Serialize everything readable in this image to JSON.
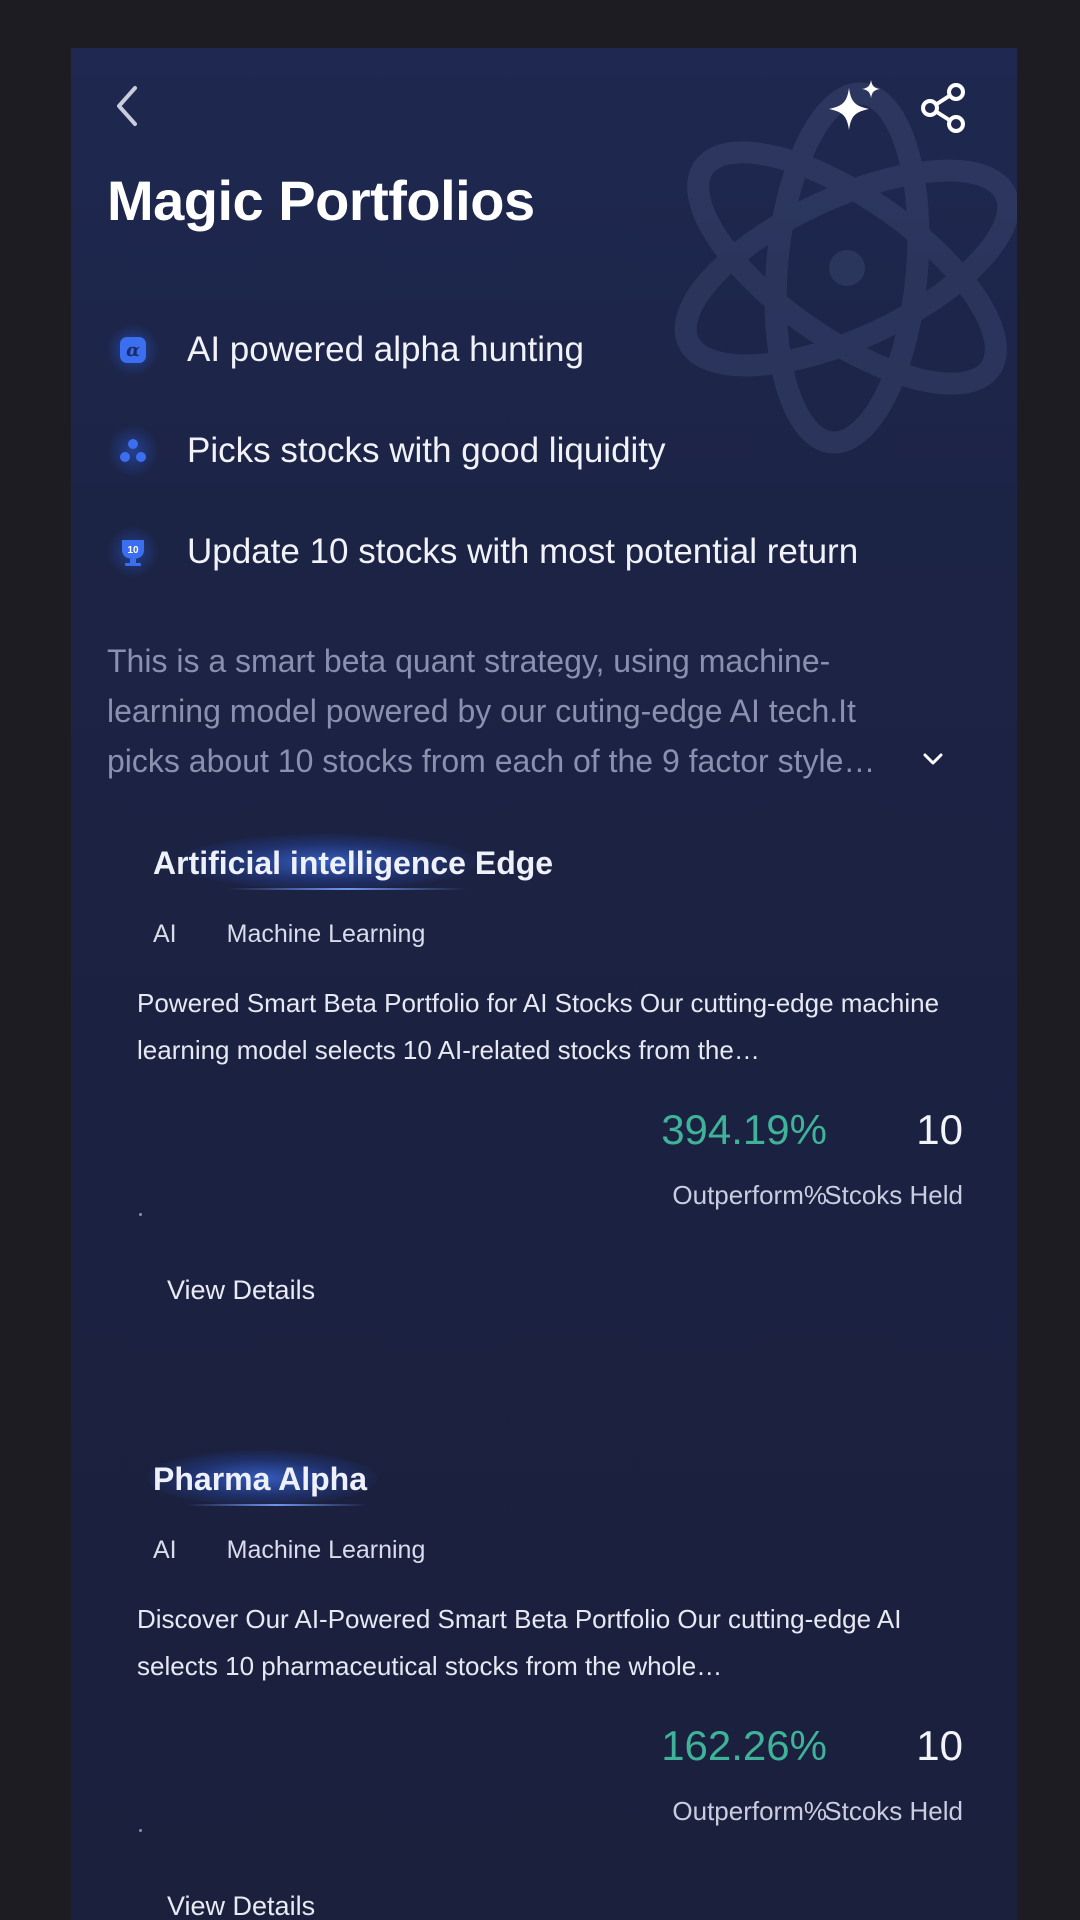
{
  "header": {
    "title": "Magic Portfolios",
    "back_icon": "chevron-left-icon",
    "sparkle_icon": "sparkle-icon",
    "share_icon": "share-icon"
  },
  "features": [
    {
      "icon": "alpha-icon",
      "label": "AI powered alpha hunting"
    },
    {
      "icon": "liquidity-icon",
      "label": "Picks stocks with good liquidity"
    },
    {
      "icon": "trophy-10-icon",
      "label": "Update 10 stocks with most potential return"
    }
  ],
  "feature_icon_badge_text": "10",
  "description": {
    "text": "This is a smart beta quant strategy, using machine-learning model powered by our cuting-edge AI tech.It picks about 10 stocks from each of the 9 factor style…",
    "expand_icon": "chevron-down-icon"
  },
  "portfolios": [
    {
      "title": "Artificial intelligence Edge",
      "tags": [
        "AI",
        "Machine Learning"
      ],
      "description": "Powered Smart Beta Portfolio for AI Stocks Our cutting-edge machine learning model selects 10 AI-related stocks from the…",
      "outperform_value": "394.19%",
      "outperform_label": "Outperform%",
      "stocks_value": "10",
      "stocks_label": "Stcoks Held",
      "view_details": "View Details"
    },
    {
      "title": "Pharma Alpha",
      "tags": [
        "AI",
        "Machine Learning"
      ],
      "description": "Discover Our AI-Powered Smart Beta Portfolio Our cutting-edge AI selects 10 pharmaceutical stocks from the whole…",
      "outperform_value": "162.26%",
      "outperform_label": "Outperform%",
      "stocks_value": "10",
      "stocks_label": "Stcoks Held",
      "view_details": "View Details"
    }
  ],
  "colors": {
    "background": "#1c2344",
    "positive": "#3fb39a",
    "accent": "#3b6ff0"
  }
}
